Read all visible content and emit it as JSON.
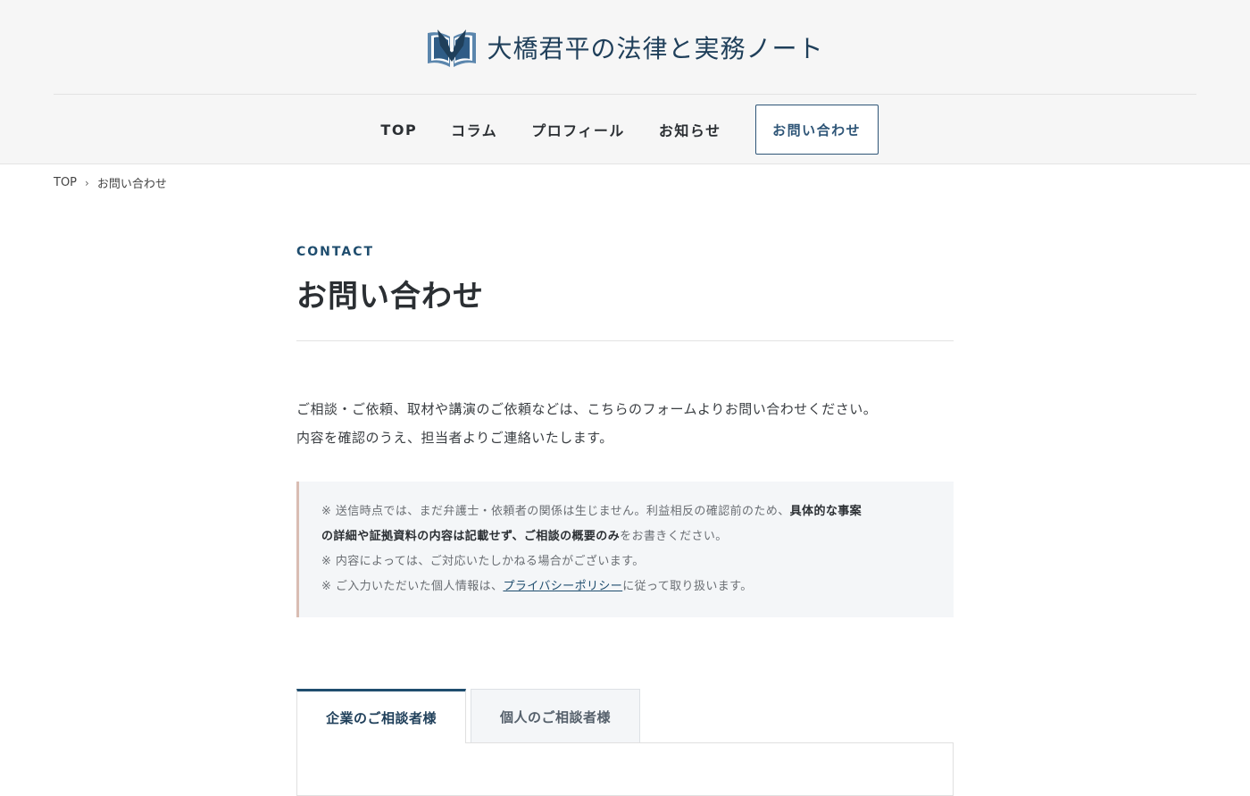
{
  "header": {
    "site_name": "大橋君平の法律と実務ノート",
    "logo_icon": "open-book-pen-icon",
    "brand_color": "#1f3f5a"
  },
  "nav": {
    "items": [
      {
        "label": "TOP"
      },
      {
        "label": "コラム"
      },
      {
        "label": "プロフィール"
      },
      {
        "label": "お知らせ"
      }
    ],
    "cta_label": "お問い合わせ"
  },
  "breadcrumb": {
    "home": "TOP",
    "separator_icon": "chevron-right-icon",
    "current": "お問い合わせ"
  },
  "page": {
    "section_en": "CONTACT",
    "title": "お問い合わせ",
    "lead_line1": "ご相談・ご依頼、取材や講演のご依頼などは、こちらのフォームよりお問い合わせください。",
    "lead_line2": "内容を確認のうえ、担当者よりご連絡いたします。"
  },
  "notice": {
    "line1_prefix": "※ 送信時点では、まだ弁護士・依頼者の関係は生じません。利益相反の確認前のため、",
    "line1_bold": "具体的な事案",
    "line2_bold": "の詳細や証拠資料の内容は記載せず、ご相談の概要のみ",
    "line2_suffix": "をお書きください。",
    "line3": "※ 内容によっては、ご対応いたしかねる場合がございます。",
    "line4_prefix": "※ ご入力いただいた個人情報は、",
    "line4_link": "プライバシーポリシー",
    "line4_suffix": "に従って取り扱います。"
  },
  "tabs": {
    "corporate": "企業のご相談者様",
    "individual": "個人のご相談者様",
    "active": "corporate"
  },
  "colors": {
    "accent": "#1f4d6e",
    "notice_border": "#d9bdb3",
    "header_bg": "#f6f6f6"
  }
}
